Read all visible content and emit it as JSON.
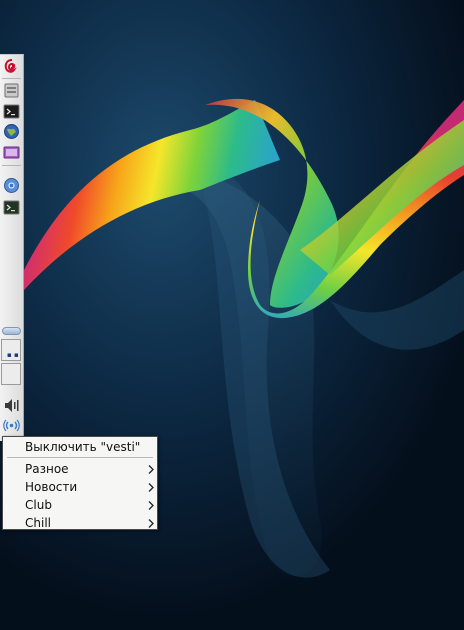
{
  "panel": {
    "launchers": [
      {
        "name": "debian-menu-icon"
      },
      {
        "name": "file-manager-icon"
      },
      {
        "name": "terminal-icon"
      },
      {
        "name": "web-browser-icon"
      },
      {
        "name": "media-player-icon"
      },
      {
        "name": "chromium-icon"
      },
      {
        "name": "terminal-2-icon"
      }
    ],
    "tray": {
      "volume_icon": "speaker-icon",
      "radio_icon": "radio-tray-icon"
    }
  },
  "context_menu": {
    "title_item": "Выключить \"vesti\"",
    "items": [
      {
        "label": "Разное"
      },
      {
        "label": "Новости"
      },
      {
        "label": "Club"
      },
      {
        "label": "Chill"
      }
    ]
  },
  "colors": {
    "panel": "#e8e8e8",
    "menu_bg": "#f6f6f4",
    "desktop_bg": "#071a2b"
  }
}
